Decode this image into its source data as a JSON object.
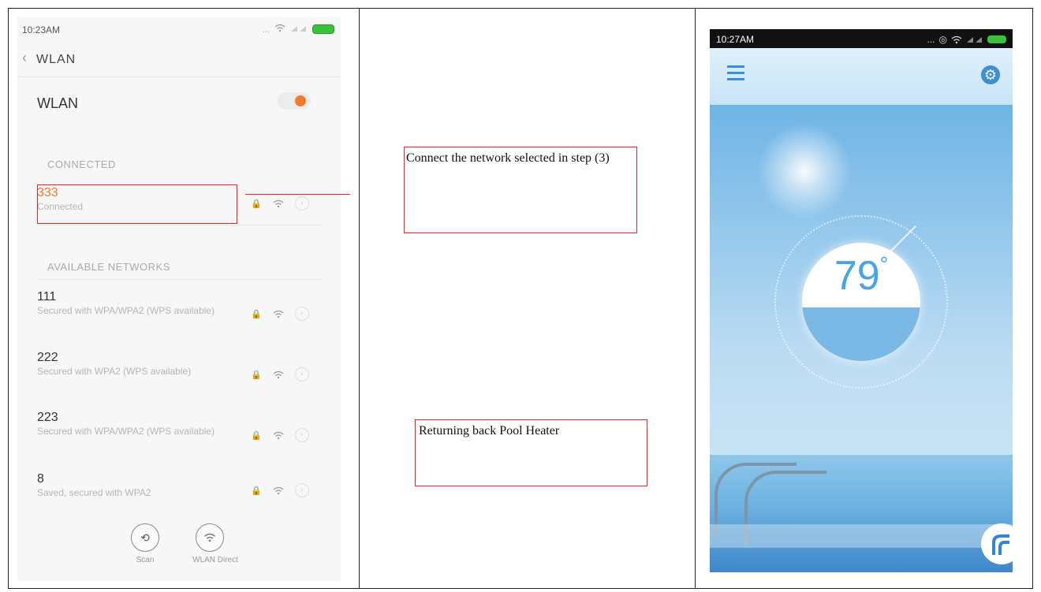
{
  "left_phone": {
    "status_time": "10:23AM",
    "header_title": "WLAN",
    "wlan_label": "WLAN",
    "connected_section": "CONNECTED",
    "connected_network": {
      "name": "333",
      "status": "Connected"
    },
    "available_section": "AVAILABLE NETWORKS",
    "networks": [
      {
        "name": "111",
        "detail": "Secured with WPA/WPA2 (WPS available)"
      },
      {
        "name": "222",
        "detail": "Secured with WPA2 (WPS available)"
      },
      {
        "name": "223",
        "detail": "Secured with WPA/WPA2 (WPS available)"
      },
      {
        "name": "8",
        "detail": "Saved, secured with WPA2"
      }
    ],
    "buttons": {
      "scan": "Scan",
      "wlan_direct": "WLAN Direct"
    }
  },
  "notes": {
    "connect": "Connect the network selected in step (3)",
    "returning": "Returning back Pool Heater"
  },
  "right_phone": {
    "status_time": "10:27AM",
    "temperature": "79",
    "degree": "°"
  },
  "colors": {
    "accent": "#f07b2a",
    "annotation": "#e22222",
    "app_blue": "#3a8fd6"
  }
}
